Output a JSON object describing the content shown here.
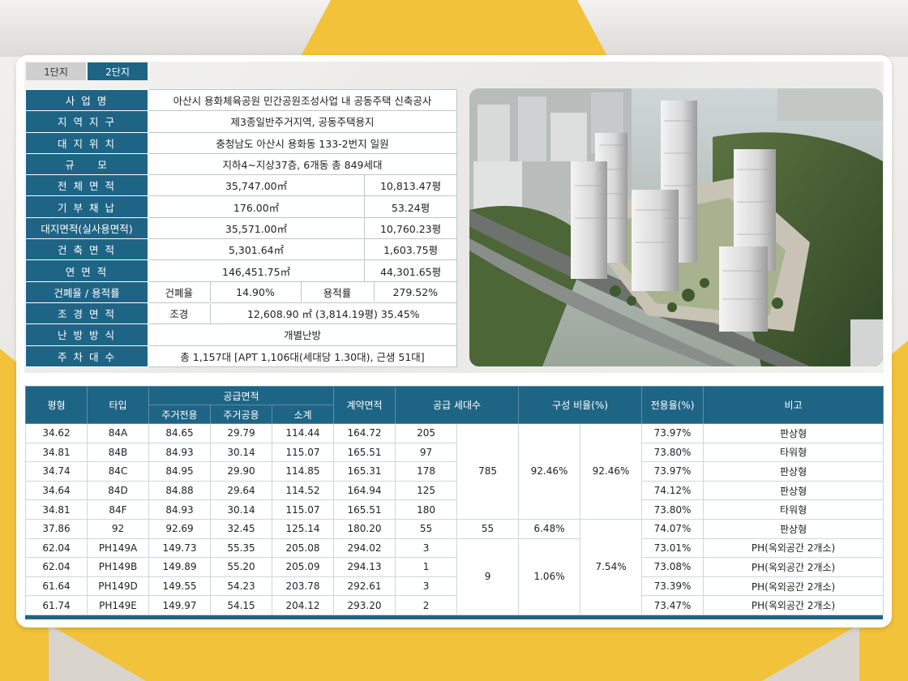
{
  "tabs": [
    {
      "label": "1단지"
    },
    {
      "label": "2단지"
    }
  ],
  "info": {
    "project_label": "사 업 명",
    "project_value": "아산시 용화체육공원 민간공원조성사업 내 공동주택 신축공사",
    "zone_label": "지 역 지 구",
    "zone_value": "제3종일반주거지역, 공동주택용지",
    "site_label": "대 지 위 치",
    "site_value": "충청남도 아산시 용화동 133-2번지 일원",
    "scale_label": "규 　 모",
    "scale_value": "지하4~지상37층, 6개동 총 849세대",
    "total_area_label": "전 체 면 적",
    "total_area_m2": "35,747.00㎡",
    "total_area_py": "10,813.47평",
    "donation_label": "기 부 채 납",
    "donation_m2": "176.00㎡",
    "donation_py": "53.24평",
    "land_label": "대지면적(실사용면적)",
    "land_m2": "35,571.00㎡",
    "land_py": "10,760.23평",
    "building_label": "건 축 면 적",
    "building_m2": "5,301.64㎡",
    "building_py": "1,603.75평",
    "floor_label": "연 면 적",
    "floor_m2": "146,451.75㎡",
    "floor_py": "44,301.65평",
    "ratio_label": "건폐율 / 용적률",
    "coverage_label": "건폐율",
    "coverage_value": "14.90%",
    "far_label": "용적률",
    "far_value": "279.52%",
    "landscape_label": "조 경 면 적",
    "landscape_sub": "조경",
    "landscape_value": "12,608.90 ㎡ (3,814.19평) 35.45%",
    "heating_label": "난 방 방 식",
    "heating_value": "개별난방",
    "parking_label": "주 차 대 수",
    "parking_value": "총 1,157대 [APT 1,106대(세대당 1.30대), 근생 51대]"
  },
  "units_header": {
    "pyeong": "평형",
    "type": "타입",
    "supply_area": "공급면적",
    "exclusive": "주거전용",
    "common": "주거공용",
    "subtotal": "소계",
    "contract": "계약면적",
    "households": "공급 세대수",
    "ratio": "구성 비율(%)",
    "exclusive_ratio": "전용율(%)",
    "note": "비고"
  },
  "units_rows": [
    {
      "pyeong": "34.62",
      "type": "84A",
      "exclusive": "84.65",
      "common": "29.79",
      "subtotal": "114.44",
      "contract": "164.72",
      "households": "205",
      "exclusive_ratio": "73.97%",
      "note": "판상형"
    },
    {
      "pyeong": "34.81",
      "type": "84B",
      "exclusive": "84.93",
      "common": "30.14",
      "subtotal": "115.07",
      "contract": "165.51",
      "households": "97",
      "exclusive_ratio": "73.80%",
      "note": "타워형"
    },
    {
      "pyeong": "34.74",
      "type": "84C",
      "exclusive": "84.95",
      "common": "29.90",
      "subtotal": "114.85",
      "contract": "165.31",
      "households": "178",
      "exclusive_ratio": "73.97%",
      "note": "판상형"
    },
    {
      "pyeong": "34.64",
      "type": "84D",
      "exclusive": "84.88",
      "common": "29.64",
      "subtotal": "114.52",
      "contract": "164.94",
      "households": "125",
      "exclusive_ratio": "74.12%",
      "note": "판상형"
    },
    {
      "pyeong": "34.81",
      "type": "84F",
      "exclusive": "84.93",
      "common": "30.14",
      "subtotal": "115.07",
      "contract": "165.51",
      "households": "180",
      "exclusive_ratio": "73.80%",
      "note": "타워형"
    },
    {
      "pyeong": "37.86",
      "type": "92",
      "exclusive": "92.69",
      "common": "32.45",
      "subtotal": "125.14",
      "contract": "180.20",
      "households": "55",
      "exclusive_ratio": "74.07%",
      "note": "판상형"
    },
    {
      "pyeong": "62.04",
      "type": "PH149A",
      "exclusive": "149.73",
      "common": "55.35",
      "subtotal": "205.08",
      "contract": "294.02",
      "households": "3",
      "exclusive_ratio": "73.01%",
      "note": "PH(옥외공간 2개소)"
    },
    {
      "pyeong": "62.04",
      "type": "PH149B",
      "exclusive": "149.89",
      "common": "55.20",
      "subtotal": "205.09",
      "contract": "294.13",
      "households": "1",
      "exclusive_ratio": "73.08%",
      "note": "PH(옥외공간 2개소)"
    },
    {
      "pyeong": "61.64",
      "type": "PH149D",
      "exclusive": "149.55",
      "common": "54.23",
      "subtotal": "203.78",
      "contract": "292.61",
      "households": "3",
      "exclusive_ratio": "73.39%",
      "note": "PH(옥외공간 2개소)"
    },
    {
      "pyeong": "61.74",
      "type": "PH149E",
      "exclusive": "149.97",
      "common": "54.15",
      "subtotal": "204.12",
      "contract": "293.20",
      "households": "2",
      "exclusive_ratio": "73.47%",
      "note": "PH(옥외공간 2개소)"
    }
  ],
  "groups": {
    "g84_total": "785",
    "g84_ratio": "92.46%",
    "g84_group_ratio": "92.46%",
    "g92_total": "55",
    "g92_ratio": "6.48%",
    "gph_total": "9",
    "gph_ratio": "1.06%",
    "gbig_group_ratio": "7.54%"
  },
  "colors": {
    "primary": "#1e6585",
    "accent_yellow": "#f3c23b"
  }
}
